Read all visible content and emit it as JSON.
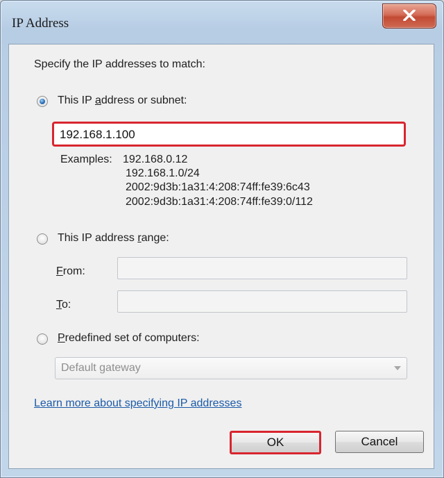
{
  "window": {
    "title": "IP Address",
    "close_icon": "close-icon"
  },
  "instruction": "Specify the IP addresses to match:",
  "option_subnet": {
    "pre": "This IP ",
    "accel": "a",
    "post": "ddress or subnet:",
    "selected": true,
    "value": "192.168.1.100"
  },
  "examples": {
    "label": "Examples:",
    "lines": [
      "192.168.0.12",
      "192.168.1.0/24",
      "2002:9d3b:1a31:4:208:74ff:fe39:6c43",
      "2002:9d3b:1a31:4:208:74ff:fe39:0/112"
    ]
  },
  "option_range": {
    "pre": "This IP address ",
    "accel": "r",
    "post": "ange:",
    "selected": false,
    "from_accel": "F",
    "from_post": "rom:",
    "to_accel": "T",
    "to_post": "o:",
    "from_value": "",
    "to_value": ""
  },
  "option_predefined": {
    "accel": "P",
    "post": "redefined set of computers:",
    "selected": false,
    "selected_value": "Default gateway"
  },
  "help_link": "Learn more about specifying IP addresses",
  "buttons": {
    "ok": "OK",
    "cancel": "Cancel"
  },
  "colors": {
    "highlight": "#d9252f",
    "link": "#1a5aa8"
  }
}
